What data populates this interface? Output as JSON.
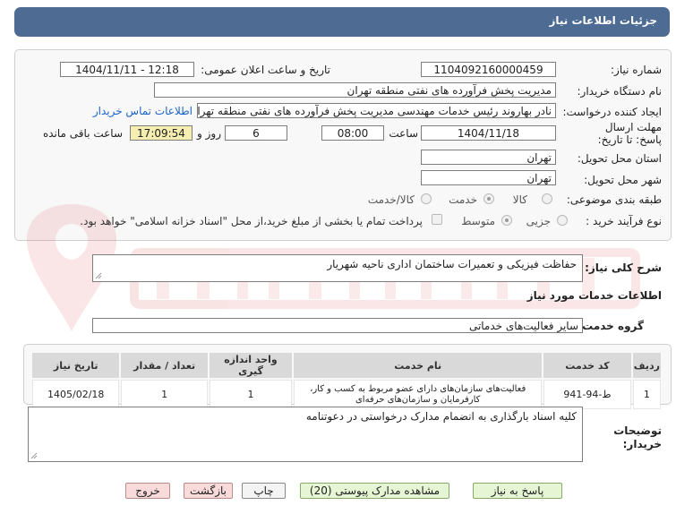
{
  "header": {
    "title": "جزئیات اطلاعات نیاز"
  },
  "form": {
    "need_number_label": "شماره نیاز:",
    "need_number": "1104092160000459",
    "announce_label": "تاریخ و ساعت اعلان عمومی:",
    "announce_value": "1404/11/11 - 12:18",
    "buyer_org_label": "نام دستگاه خریدار:",
    "buyer_org": "مدیریت پخش فرآورده های نفتی منطقه تهران",
    "creator_label": "ایجاد کننده درخواست:",
    "creator": "نادر بهاروند رئیس خدمات مهندسی مدیریت پخش فرآورده های نفتی منطقه تهران",
    "contact_link": "اطلاعات تماس خریدار",
    "deadline_label": "مهلت ارسال پاسخ: تا تاریخ:",
    "deadline_date": "1404/11/18",
    "time_label": "ساعت",
    "deadline_time": "08:00",
    "days_value": "6",
    "days_label": "روز و",
    "remaining_time": "17:09:54",
    "remaining_label": "ساعت باقی مانده",
    "province_label": "استان محل تحویل:",
    "province": "تهران",
    "city_label": "شهر محل تحویل:",
    "city": "تهران",
    "category_label": "طبقه بندی موضوعی:",
    "category_options": [
      "کالا",
      "خدمت",
      "کالا/خدمت"
    ],
    "purchase_type_label": "نوع فرآیند خرید :",
    "purchase_options": [
      "جزیی",
      "متوسط"
    ],
    "payment_note": "پرداخت تمام یا بخشی از مبلغ خرید،از محل \"اسناد خزانه اسلامی\" خواهد بود."
  },
  "description": {
    "label": "شرح کلی نیاز:",
    "value": "حفاظت فیزیکی و تعمیرات ساختمان اداری ناحیه شهریار"
  },
  "services": {
    "section_title": "اطلاعات خدمات مورد نیاز",
    "group_label": "گروه خدمت:",
    "group_value": "سایر فعالیت‌های خدماتی",
    "columns": [
      "ردیف",
      "کد خدمت",
      "نام خدمت",
      "واحد اندازه گیری",
      "تعداد / مقدار",
      "تاریخ نیاز"
    ],
    "rows": [
      {
        "row": "1",
        "code": "ط-94-941",
        "name": "فعالیت‌های سازمان‌های دارای عضو مربوط به کسب و کار، کارفرمایان و سازمان‌های حرفه‌ای",
        "unit": "1",
        "qty": "1",
        "date": "1405/02/18"
      }
    ]
  },
  "buyer_notes": {
    "label": "توضیحات خریدار:",
    "value": "کلیه اسناد بارگذاری به انضمام مدارک درخواستی در دعوتنامه"
  },
  "buttons": {
    "reply": "پاسخ به نیاز",
    "attachments": "مشاهده مدارک پیوستی (20)",
    "print": "چاپ",
    "back": "بازگشت",
    "exit": "خروج"
  }
}
